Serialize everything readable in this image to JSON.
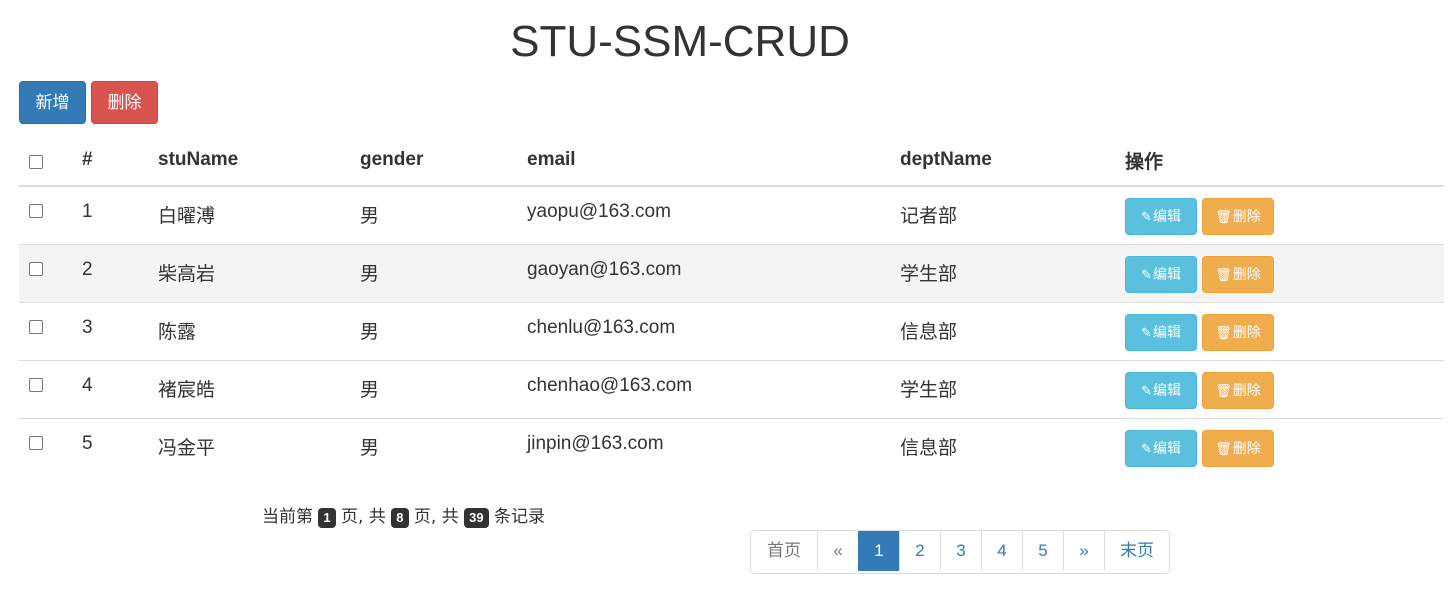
{
  "page": {
    "title": "STU-SSM-CRUD"
  },
  "toolbar": {
    "add_label": "新增",
    "delete_label": "删除"
  },
  "table": {
    "headers": {
      "index": "#",
      "name": "stuName",
      "gender": "gender",
      "email": "email",
      "dept": "deptName",
      "actions": "操作"
    },
    "edit_label": "编辑",
    "delete_label": "删除",
    "edit_icon": "pencil-icon",
    "delete_icon": "trash-icon",
    "rows": [
      {
        "id": "1",
        "name": "白曜溥",
        "gender": "男",
        "email": "yaopu@163.com",
        "dept": "记者部"
      },
      {
        "id": "2",
        "name": "柴高岩",
        "gender": "男",
        "email": "gaoyan@163.com",
        "dept": "学生部"
      },
      {
        "id": "3",
        "name": "陈露",
        "gender": "男",
        "email": "chenlu@163.com",
        "dept": "信息部"
      },
      {
        "id": "4",
        "name": "褚宸皓",
        "gender": "男",
        "email": "chenhao@163.com",
        "dept": "学生部"
      },
      {
        "id": "5",
        "name": "冯金平",
        "gender": "男",
        "email": "jinpin@163.com",
        "dept": "信息部"
      }
    ]
  },
  "page_info": {
    "prefix": "当前第",
    "current": "1",
    "mid1": "页, 共",
    "total_pages": "8",
    "mid2": "页, 共",
    "total_records": "39",
    "suffix": "条记录"
  },
  "pagination": {
    "first": "首页",
    "prev": "«",
    "pages": [
      "1",
      "2",
      "3",
      "4",
      "5"
    ],
    "active_page": "1",
    "next": "»",
    "last": "末页"
  },
  "colors": {
    "primary": "#337ab7",
    "danger": "#d9534f",
    "info": "#5bc0de",
    "warning": "#f0ad4e"
  }
}
